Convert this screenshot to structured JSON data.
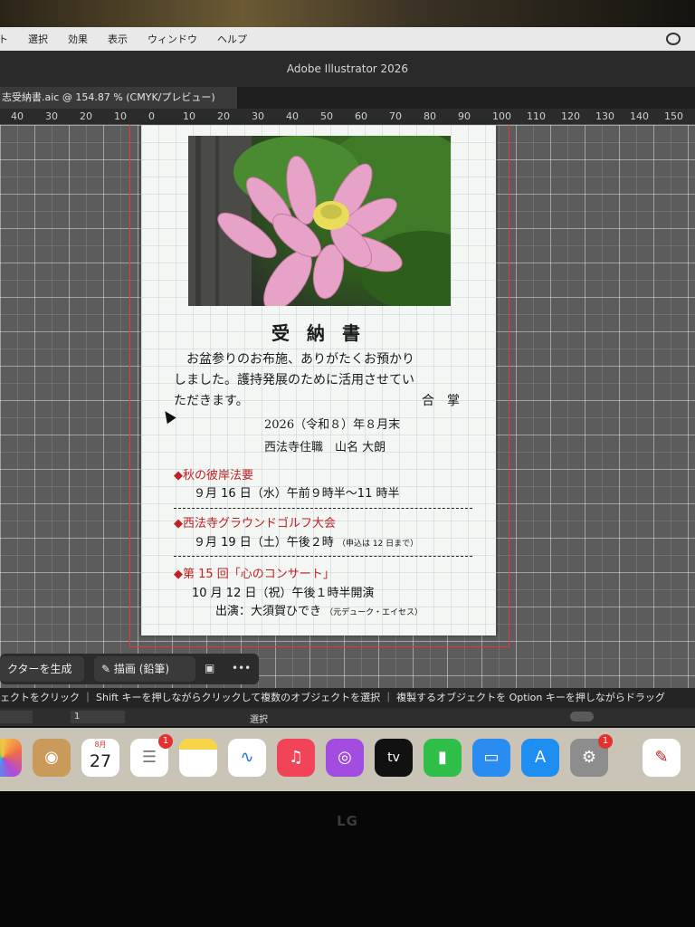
{
  "menubar": {
    "items": [
      "ト",
      "選択",
      "効果",
      "表示",
      "ウィンドウ",
      "ヘルプ"
    ]
  },
  "window": {
    "title": "Adobe Illustrator 2026"
  },
  "document_tab": {
    "label": "志受納書.aic @ 154.87 % (CMYK/プレビュー)"
  },
  "ruler": {
    "ticks": [
      "40",
      "30",
      "20",
      "10",
      "0",
      "10",
      "20",
      "30",
      "40",
      "50",
      "60",
      "70",
      "80",
      "90",
      "100",
      "110",
      "120",
      "130",
      "140",
      "150"
    ]
  },
  "document": {
    "title": "受 納 書",
    "body": [
      "お盆参りのお布施、ありがたくお預かり",
      "しました。護持発展のために活用させてい",
      "ただきます。"
    ],
    "gassho": "合　掌",
    "date": "2026（令和８）年８月末",
    "priest": "西法寺住職　山名 大朗",
    "events": [
      {
        "title": "◆秋の彼岸法要",
        "line": "９月 16 日（水）午前９時半〜11 時半",
        "note": ""
      },
      {
        "title": "◆西法寺グラウンドゴルフ大会",
        "line": "９月 19 日（土）午後２時",
        "note": "（申込は 12 日まで）"
      },
      {
        "title": "◆第 15 回「心のコンサート」",
        "line": "10 月 12 日（祝）午後１時半開演",
        "line2": "出演：大須賀ひでき",
        "note": "（元デューク・エイセス）"
      }
    ]
  },
  "taskbar": {
    "generate_label": "クターを生成",
    "draw_label": "描画 (鉛筆)",
    "more": "•••"
  },
  "hint": "ェクトをクリック ｜ Shift キーを押しながらクリックして複数のオブジェクトを選択 ｜ 複製するオブジェクトを Option キーを押しながらドラッグ",
  "status": {
    "page": "1",
    "mode": "選択"
  },
  "dock": {
    "calendar_month": "8月",
    "calendar_day": "27",
    "reminders_badge": "1",
    "settings_badge": "1",
    "icons": [
      "photos-icon",
      "contacts-icon",
      "calendar-icon",
      "reminders-icon",
      "notes-icon",
      "freeform-icon",
      "music-icon",
      "podcasts-icon",
      "tv-icon",
      "numbers-icon",
      "keynote-icon",
      "app-store-icon",
      "settings-icon",
      "textedit-icon"
    ],
    "tv_label": "tv"
  },
  "monitor": {
    "brand": "LG"
  },
  "colors": {
    "accent_red": "#c02020",
    "guide_red": "#e03a3a"
  }
}
